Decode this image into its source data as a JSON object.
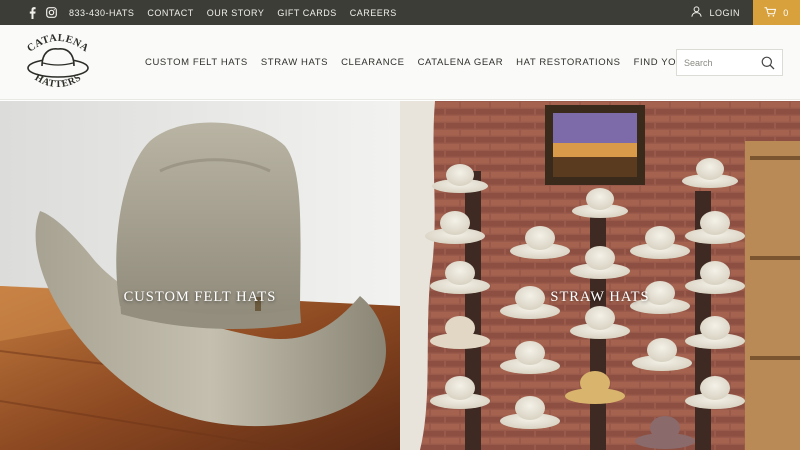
{
  "topbar": {
    "phone": "833-430-HATS",
    "links": [
      "CONTACT",
      "OUR STORY",
      "GIFT CARDS",
      "CAREERS"
    ],
    "social_icons": [
      "facebook-icon",
      "instagram-icon"
    ],
    "login_label": "LOGIN",
    "cart_count": "0",
    "colors": {
      "bar": "#3d3d38",
      "cart": "#d8a13b"
    }
  },
  "header": {
    "logo_text_top": "CATALENA",
    "logo_text_bottom": "HATTERS",
    "nav": [
      "CUSTOM FELT HATS",
      "STRAW HATS",
      "CLEARANCE",
      "CATALENA GEAR",
      "HAT RESTORATIONS",
      "FIND YOUR FIT"
    ],
    "search_placeholder": "Search"
  },
  "hero": {
    "tiles": [
      {
        "label": "CUSTOM FELT HATS",
        "image": "felt-hat-photo"
      },
      {
        "label": "STRAW HATS",
        "image": "straw-hats-wall-photo"
      }
    ]
  }
}
